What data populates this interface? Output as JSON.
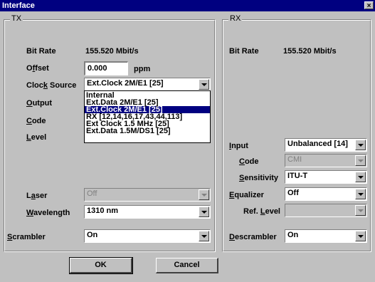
{
  "window": {
    "title": "Interface",
    "close_glyph": "×"
  },
  "tx": {
    "legend": "TX",
    "bit_rate_label": "Bit Rate",
    "bit_rate_value": "155.520 Mbit/s",
    "offset_label_pre": "O",
    "offset_label_acc": "f",
    "offset_label_post": "fset",
    "offset_value": "0.000",
    "offset_unit": "ppm",
    "clock_label_pre": "Cloc",
    "clock_label_acc": "k",
    "clock_label_post": " Source",
    "clock_value": "Ext.Clock 2M/E1 [25]",
    "clock_options": [
      "Internal",
      "Ext.Data 2M/E1 [25]",
      "Ext.Clock 2M/E1 [25]",
      "RX [12,14,16,17,43,44,113]",
      "Ext Clock 1.5 MHz [25]",
      "Ext.Data 1.5M/DS1 [25]"
    ],
    "clock_selected_index": 2,
    "output_label_acc": "O",
    "output_label_post": "utput",
    "code_label_acc": "C",
    "code_label_post": "ode",
    "level_label_acc": "L",
    "level_label_post": "evel",
    "laser_label_pre": "L",
    "laser_label_acc": "a",
    "laser_label_post": "ser",
    "laser_value": "Off",
    "wavelength_label_acc": "W",
    "wavelength_label_post": "avelength",
    "wavelength_value": "1310 nm",
    "scrambler_label_acc": "S",
    "scrambler_label_post": "crambler",
    "scrambler_value": "On"
  },
  "rx": {
    "legend": "RX",
    "bit_rate_label": "Bit Rate",
    "bit_rate_value": "155.520 Mbit/s",
    "input_label_acc": "I",
    "input_label_post": "nput",
    "input_value": "Unbalanced [14]",
    "code_label_acc": "C",
    "code_label_post": "ode",
    "code_value": "CMI",
    "sensitivity_label_acc": "S",
    "sensitivity_label_post": "ensitivity",
    "sensitivity_value": "ITU-T",
    "equalizer_label_acc": "E",
    "equalizer_label_post": "qualizer",
    "equalizer_value": "Off",
    "ref_level_label_pre": "Ref. ",
    "ref_level_label_acc": "L",
    "ref_level_label_post": "evel",
    "ref_level_value": "",
    "descrambler_label_acc": "D",
    "descrambler_label_post": "escrambler",
    "descrambler_value": "On"
  },
  "buttons": {
    "ok": "OK",
    "cancel": "Cancel"
  }
}
